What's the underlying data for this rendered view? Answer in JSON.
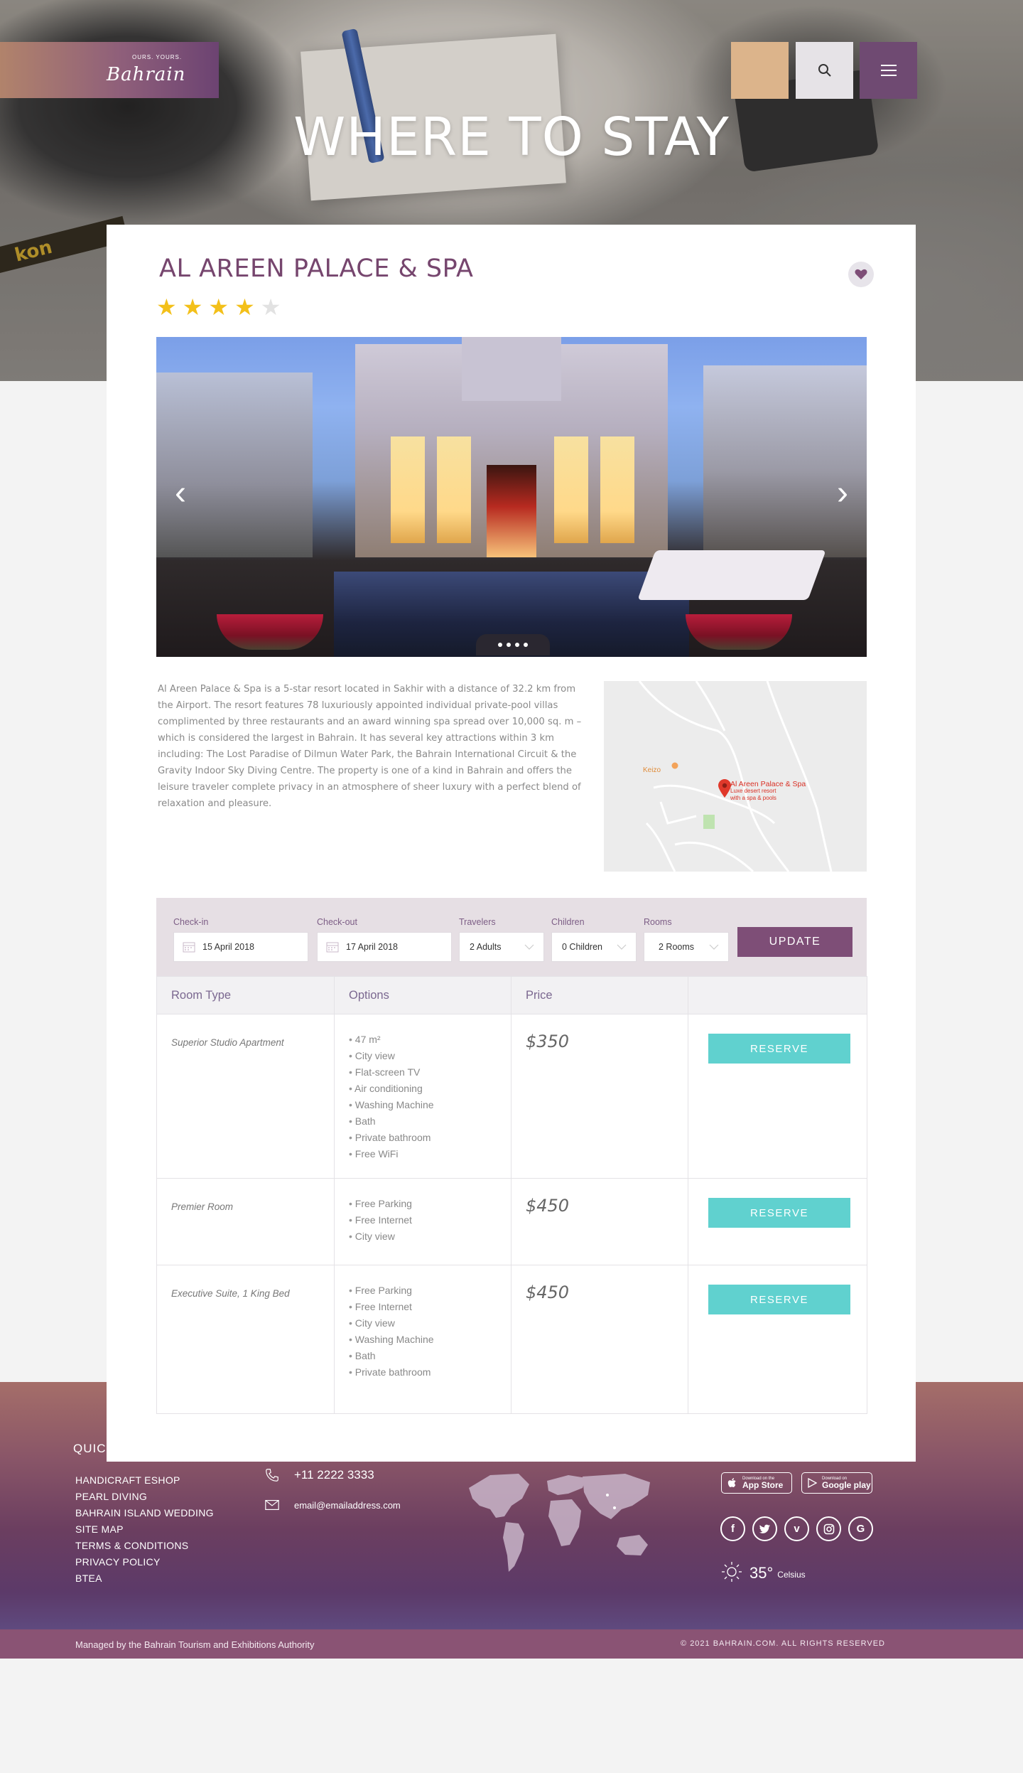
{
  "header": {
    "logo_tagline": "OURS. YOURS.",
    "logo_word": "Bahrain",
    "page_title": "WHERE TO STAY",
    "hero_strap_text": "kon"
  },
  "hotel": {
    "name": "AL AREEN PALACE & SPA",
    "rating": 4,
    "rating_max": 5,
    "description": "Al Areen Palace & Spa is a 5-star resort located in Sakhir with a distance of 32.2 km from the Airport. The resort features 78 luxuriously appointed individual private-pool villas complimented by three restaurants and an award winning spa spread over 10,000 sq. m – which is considered the largest in Bahrain. It has several key attractions within 3 km including: The Lost Paradise of Dilmun Water Park, the Bahrain International Circuit & the Gravity Indoor Sky Diving Centre. The property is one of a kind in Bahrain and offers the leisure traveler complete privacy in an atmosphere of sheer luxury with a perfect blend of relaxation and pleasure.",
    "map": {
      "place_name": "Al Areen Palace & Spa",
      "place_sub1": "Luxe desert resort",
      "place_sub2": "with a spa & pools",
      "poi": "Keizo"
    }
  },
  "booking": {
    "checkin_label": "Check-in",
    "checkin_value": "15 April 2018",
    "checkout_label": "Check-out",
    "checkout_value": "17 April 2018",
    "travelers_label": "Travelers",
    "travelers_value": "2 Adults",
    "children_label": "Children",
    "children_value": "0 Children",
    "rooms_label": "Rooms",
    "rooms_value": "2 Rooms",
    "update_label": "UPDATE"
  },
  "rooms_table": {
    "headers": [
      "Room Type",
      "Options",
      "Price",
      ""
    ],
    "reserve_label": "RESERVE",
    "rows": [
      {
        "type": "Superior Studio Apartment",
        "price": "$350",
        "options": [
          "47 m²",
          "City view",
          "Flat-screen TV",
          "Air conditioning",
          "Washing Machine",
          "Bath",
          "Private bathroom",
          "Free WiFi"
        ]
      },
      {
        "type": "Premier Room",
        "price": "$450",
        "options": [
          "Free Parking",
          "Free Internet",
          "City view"
        ]
      },
      {
        "type": "Executive Suite, 1 King Bed",
        "price": "$450",
        "options": [
          "Free Parking",
          "Free Internet",
          "City view",
          "Washing Machine",
          "Bath",
          "Private bathroom"
        ]
      }
    ]
  },
  "footer": {
    "quick_title": "QUICK",
    "quick_links": [
      "HANDICRAFT ESHOP",
      "PEARL DIVING",
      "BAHRAIN ISLAND WEDDING",
      "SITE MAP",
      "TERMS & CONDITIONS",
      "PRIVACY POLICY",
      "BTEA"
    ],
    "phone": "+11 2222 3333",
    "email": "email@emailaddress.com",
    "appstore_small": "Download on the",
    "appstore_big": "App Store",
    "googleplay_small": "Download on",
    "googleplay_big": "Google play",
    "socials": [
      "facebook-icon",
      "twitter-icon",
      "vimeo-icon",
      "instagram-icon",
      "google-icon"
    ],
    "temperature": "35°",
    "temperature_unit": "Celsius",
    "managed_by": "Managed by the Bahrain Tourism and Exhibitions Authority",
    "copyright": "© 2021 BAHRAIN.COM. ALL RIGHTS RESERVED"
  },
  "colors": {
    "brand_purple": "#76466e",
    "accent_peach": "#dcb48b",
    "reserve_teal": "#60d1cf",
    "star_yellow": "#f3c01a"
  }
}
